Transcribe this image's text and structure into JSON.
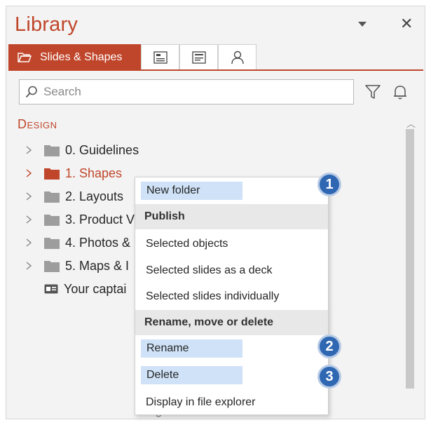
{
  "header": {
    "title": "Library"
  },
  "tabs": [
    {
      "label": "Slides & Shapes",
      "icon": "folder-open-icon",
      "active": true
    },
    {
      "label": "",
      "icon": "slide-layout-icon"
    },
    {
      "label": "",
      "icon": "slide-text-icon"
    },
    {
      "label": "",
      "icon": "person-icon"
    }
  ],
  "search": {
    "placeholder": "Search",
    "value": ""
  },
  "section": {
    "title": "Design"
  },
  "tree": [
    {
      "label": "0. Guidelines",
      "selected": false
    },
    {
      "label": "1. Shapes",
      "selected": true
    },
    {
      "label": "2. Layouts",
      "selected": false
    },
    {
      "label": "3. Product V",
      "selected": false
    },
    {
      "label": "4. Photos &",
      "selected": false
    },
    {
      "label": "5. Maps & I",
      "selected": false
    },
    {
      "label": "Your captai",
      "selected": false
    }
  ],
  "below_text": "hing",
  "context_menu": {
    "new_folder": "New folder",
    "publish_header": "Publish",
    "selected_objects": "Selected objects",
    "selected_slides_deck": "Selected slides as a deck",
    "selected_slides_individually": "Selected slides individually",
    "rename_header": "Rename, move or delete",
    "rename": "Rename",
    "delete": "Delete",
    "display_explorer": "Display in file explorer"
  },
  "callouts": [
    "1",
    "2",
    "3"
  ],
  "colors": {
    "accent": "#c0462b",
    "highlight": "#cfe2f7",
    "callout": "#2f67b3"
  }
}
